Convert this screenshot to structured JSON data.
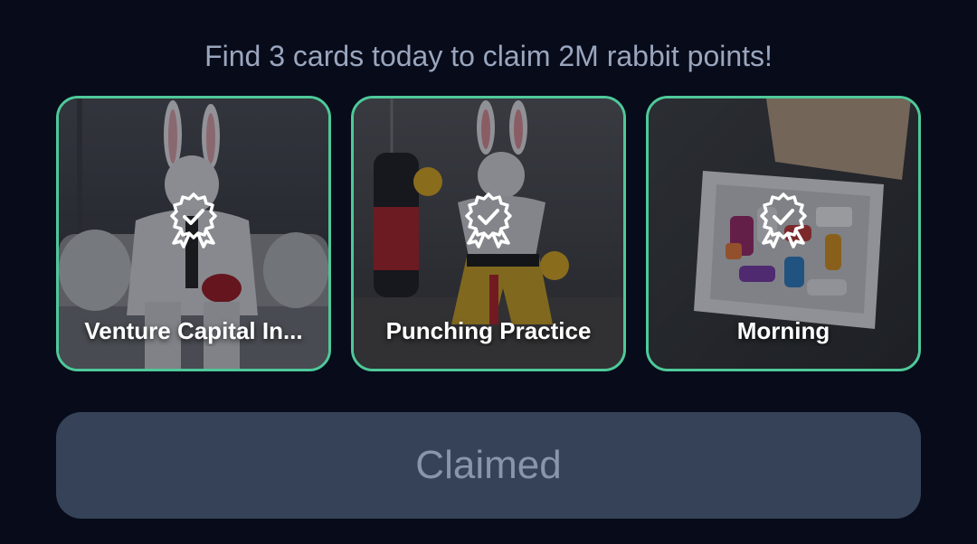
{
  "header": {
    "text": "Find 3 cards today to claim 2M rabbit points!"
  },
  "cards": [
    {
      "title": "Venture Capital In...",
      "status": "found",
      "badge_icon": "award-check-icon",
      "image": "rabbit in white suit sitting on sofa"
    },
    {
      "title": "Punching Practice",
      "status": "found",
      "badge_icon": "award-check-icon",
      "image": "muscular rabbit boxing next to punching bag"
    },
    {
      "title": "Morning",
      "status": "found",
      "badge_icon": "award-check-icon",
      "image": "open box filled with pill bottles"
    }
  ],
  "claim_button": {
    "label": "Claimed",
    "state": "disabled"
  },
  "colors": {
    "background": "#070b1a",
    "card_border": "#4ec999",
    "button_bg": "#354257",
    "button_text": "#8896ab",
    "header_text": "#9aa6bd"
  }
}
